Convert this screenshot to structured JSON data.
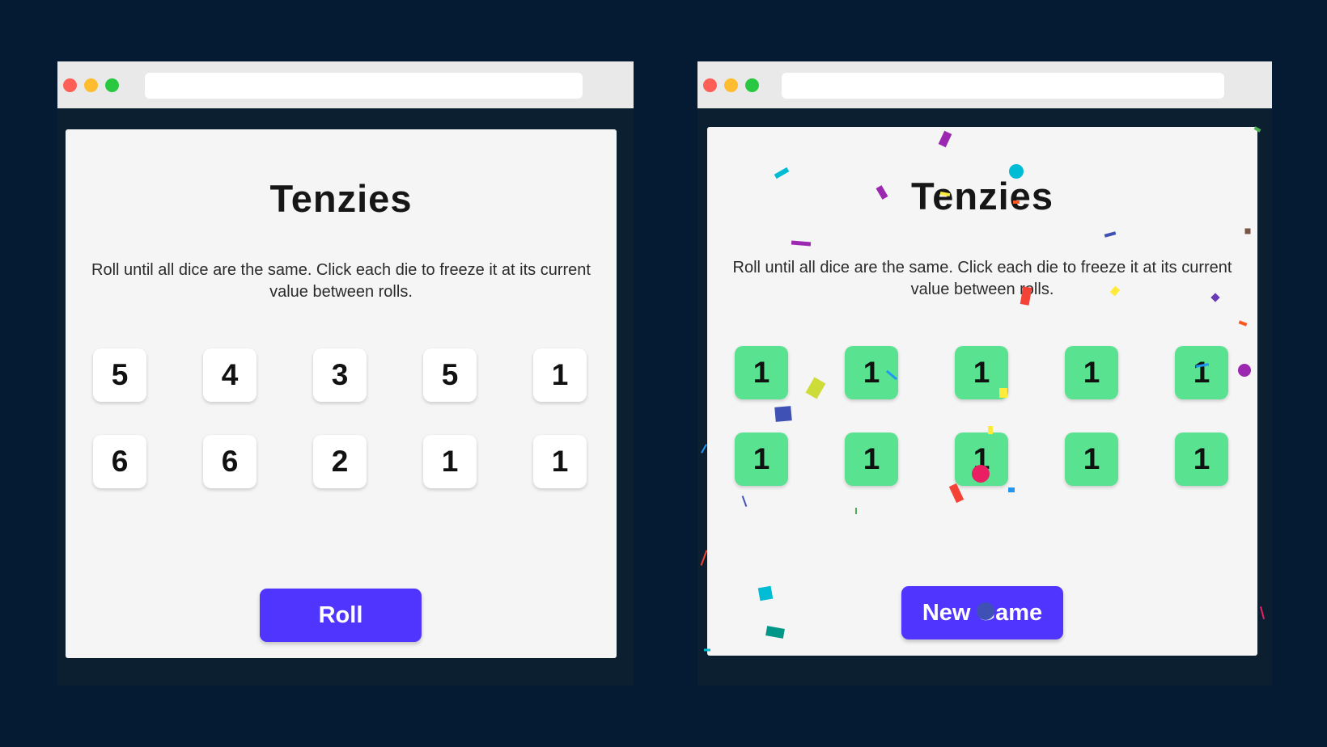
{
  "colors": {
    "page_background": "#041b33",
    "card_background": "#f5f5f5",
    "die_default": "#ffffff",
    "die_held": "#59e391",
    "button": "#5035ff",
    "button_text": "#ffffff"
  },
  "left_window": {
    "title": "Tenzies",
    "instructions": "Roll until all dice are the same. Click each die to freeze it at its current value between rolls.",
    "dice": [
      {
        "value": "5",
        "held": false
      },
      {
        "value": "4",
        "held": false
      },
      {
        "value": "3",
        "held": false
      },
      {
        "value": "5",
        "held": false
      },
      {
        "value": "1",
        "held": false
      },
      {
        "value": "6",
        "held": false
      },
      {
        "value": "6",
        "held": false
      },
      {
        "value": "2",
        "held": false
      },
      {
        "value": "1",
        "held": false
      },
      {
        "value": "1",
        "held": false
      }
    ],
    "button_label": "Roll"
  },
  "right_window": {
    "title": "Tenzies",
    "instructions": "Roll until all dice are the same. Click each die to freeze it at its current value between rolls.",
    "dice": [
      {
        "value": "1",
        "held": true
      },
      {
        "value": "1",
        "held": true
      },
      {
        "value": "1",
        "held": true
      },
      {
        "value": "1",
        "held": true
      },
      {
        "value": "1",
        "held": true
      },
      {
        "value": "1",
        "held": true
      },
      {
        "value": "1",
        "held": true
      },
      {
        "value": "1",
        "held": true
      },
      {
        "value": "1",
        "held": true
      },
      {
        "value": "1",
        "held": true
      }
    ],
    "button_label": "New Game",
    "confetti_colors": [
      "#9c27b0",
      "#00bcd4",
      "#4caf50",
      "#ffeb3b",
      "#f44336",
      "#3f51b5",
      "#2196f3",
      "#e91e63",
      "#cddc39",
      "#795548",
      "#009688",
      "#ff5722",
      "#673ab7"
    ]
  }
}
